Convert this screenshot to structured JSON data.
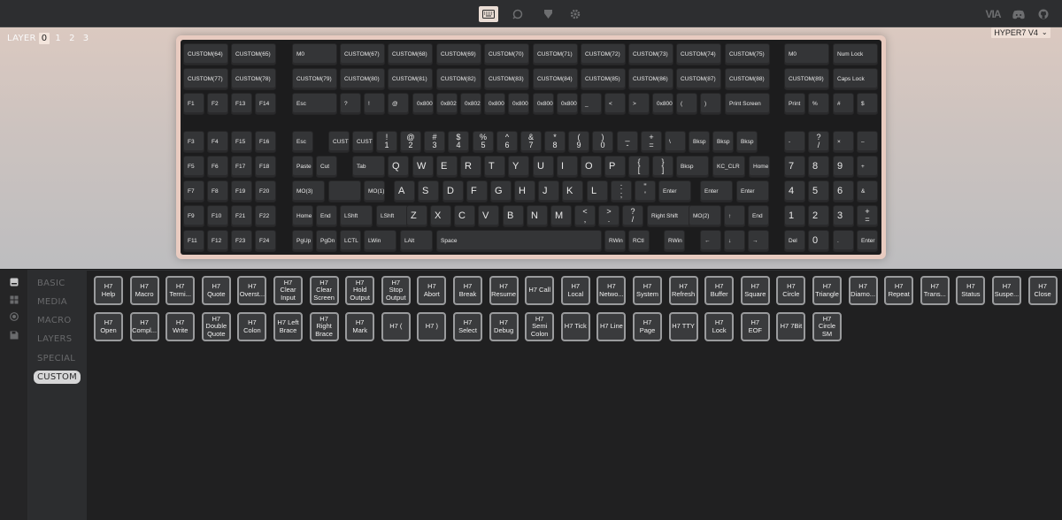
{
  "topbar": {
    "icons": [
      "keyboard-icon",
      "settings-icon",
      "bug-icon",
      "gear-icon",
      "via-logo",
      "discord-icon",
      "github-icon"
    ],
    "logo_text": "VIA"
  },
  "layers": {
    "label": "LAYER",
    "items": [
      "0",
      "1",
      "2",
      "3"
    ],
    "selected": "0"
  },
  "keyboard_select": {
    "value": "HYPER7 V4",
    "chevron": "⌄"
  },
  "keyboard": {
    "rows": [
      [
        [
          "CUSTOM(64)",
          3,
          0
        ],
        [
          "CUSTOM(65)",
          57,
          0
        ],
        [
          "M0",
          126,
          0
        ],
        [
          "CUSTOM(67)",
          180,
          0
        ],
        [
          "CUSTOM(68)",
          234,
          0
        ],
        [
          "CUSTOM(69)",
          289,
          0
        ],
        [
          "CUSTOM(70)",
          343,
          0
        ],
        [
          "CUSTOM(71)",
          398,
          0
        ],
        [
          "CUSTOM(72)",
          452,
          0
        ],
        [
          "CUSTOM(73)",
          506,
          0
        ],
        [
          "CUSTOM(74)",
          560,
          0
        ],
        [
          "CUSTOM(75)",
          615,
          0
        ],
        [
          "M0",
          682,
          0
        ],
        [
          "Num Lock",
          737,
          0
        ]
      ],
      [
        [
          "CUSTOM(77)",
          3,
          1
        ],
        [
          "CUSTOM(78)",
          57,
          1
        ],
        [
          "CUSTOM(79)",
          126,
          1
        ],
        [
          "CUSTOM(80)",
          180,
          1
        ],
        [
          "CUSTOM(81)",
          234,
          1
        ],
        [
          "CUSTOM(82)",
          289,
          1
        ],
        [
          "CUSTOM(83)",
          343,
          1
        ],
        [
          "CUSTOM(84)",
          398,
          1
        ],
        [
          "CUSTOM(85)",
          452,
          1
        ],
        [
          "CUSTOM(86)",
          506,
          1
        ],
        [
          "CUSTOM(87)",
          560,
          1
        ],
        [
          "CUSTOM(88)",
          615,
          1
        ],
        [
          "CUSTOM(89)",
          682,
          1
        ],
        [
          "Caps Lock",
          737,
          1
        ]
      ]
    ],
    "row3": [
      "F1",
      "F2",
      "F13",
      "F14",
      "Esc",
      "?",
      "!",
      "@",
      "0x800",
      "0x802",
      "0x802",
      "0x800",
      "0x800",
      "0x800",
      "0x800",
      "_",
      "<",
      ">",
      "0x800",
      "(",
      ")",
      "Print Screen",
      "Print",
      "%",
      "#",
      "$"
    ],
    "row4": [
      "F3",
      "F4",
      "F15",
      "F16",
      "Esc",
      "CUSTO",
      "CUSTO",
      "!|1",
      "@|2",
      "#|3",
      "$|4",
      "%|5",
      "^|6",
      "&|7",
      "*|8",
      "(|9",
      ")|0",
      "_|-",
      "+|=",
      "|",
      "\\",
      "Bksp",
      "Bksp",
      "Bksp",
      "-",
      "?|/",
      "×",
      "–"
    ],
    "row5": [
      "F5",
      "F6",
      "F17",
      "F18",
      "Paste",
      "Cut",
      "Tab",
      "Q",
      "W",
      "E",
      "R",
      "T",
      "Y",
      "U",
      "I",
      "O",
      "P",
      "{|[",
      "}|]",
      "Bksp",
      "KC_CLR",
      "Home",
      "7",
      "8",
      "9",
      "+"
    ],
    "row6": [
      "F7",
      "F8",
      "F19",
      "F20",
      "MO(3)",
      "",
      "MO(1)",
      "A",
      "S",
      "D",
      "F",
      "G",
      "H",
      "J",
      "K",
      "L",
      ":|;",
      "\"|'",
      "Enter",
      "Enter",
      "Enter",
      "4",
      "5",
      "6",
      "&"
    ],
    "row7": [
      "F9",
      "F10",
      "F21",
      "F22",
      "Home",
      "End",
      "LShft",
      "LShft",
      "Z",
      "X",
      "C",
      "V",
      "B",
      "N",
      "M",
      "<|,",
      ">|.",
      "?|/",
      "Right Shift",
      "MO(2)",
      "↑",
      "End",
      "1",
      "2",
      "3",
      "+|="
    ],
    "row8": [
      "F11",
      "F12",
      "F23",
      "F24",
      "PgUp",
      "PgDn",
      "LCTL",
      "LWin",
      "LAlt",
      "Space",
      "RWin",
      "RCtl",
      "RWin",
      "←",
      "↓",
      "→",
      "Del",
      "0",
      ".",
      "Enter"
    ]
  },
  "rail": {
    "icons": [
      "keycode-icon",
      "grid-icon",
      "record-icon",
      "save-icon"
    ]
  },
  "menu": {
    "items": [
      "BASIC",
      "MEDIA",
      "MACRO",
      "LAYERS",
      "SPECIAL",
      "CUSTOM"
    ],
    "selected": "CUSTOM"
  },
  "custom_keys": {
    "row1": [
      "H7 Help",
      "H7 Macro",
      "H7 Termi...",
      "H7 Quote",
      "H7 Overst...",
      "H7 Clear Input",
      "H7 Clear Screen",
      "H7 Hold Output",
      "H7 Stop Output",
      "H7 Abort",
      "H7 Break",
      "H7 Resume",
      "H7 Call",
      "H7 Local",
      "H7 Netwo...",
      "H7 System",
      "H7 Refresh",
      "H7 Buffer",
      "H7 Square",
      "H7 Circle",
      "H7 Triangle",
      "H7 Diamo...",
      "H7 Repeat",
      "H7 Trans...",
      "H7 Status",
      "H7 Suspe...",
      "H7 Close"
    ],
    "row2": [
      "H7 Open",
      "H7 Compl...",
      "H7 Write",
      "H7 Double Quote",
      "H7 Colon",
      "H7 Left Brace",
      "H7 Right Brace",
      "H7 Mark",
      "H7 (",
      "H7 )",
      "H7 Select",
      "H7 Debug",
      "H7 Semi Colon",
      "H7 Tick",
      "H7 Line",
      "H7 Page",
      "H7 TTY",
      "H7 Lock",
      "H7 EOF",
      "H7 7Bit",
      "H7 Circle SM"
    ]
  }
}
